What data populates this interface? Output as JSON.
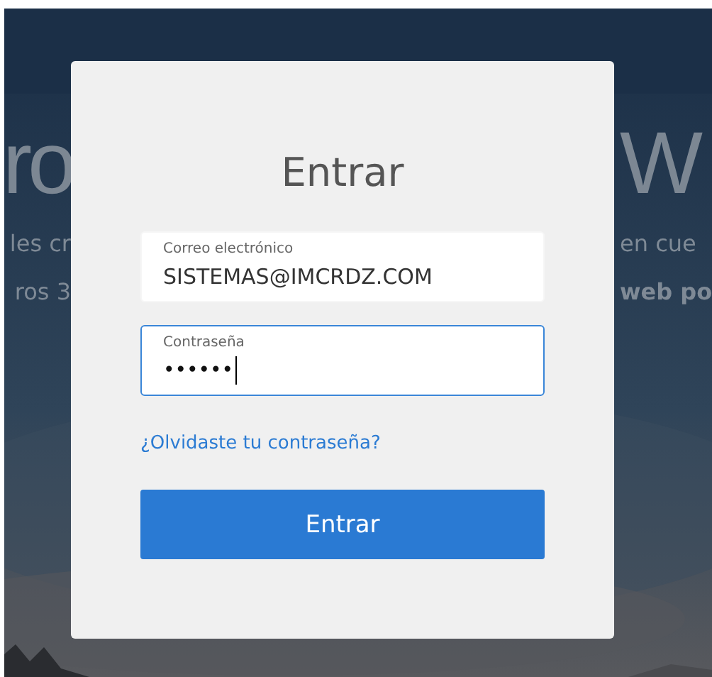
{
  "background": {
    "left_texts": [
      "ro",
      "les cr",
      "ros 3"
    ],
    "right_texts": [
      "W",
      "en cue",
      "web po"
    ]
  },
  "login": {
    "title": "Entrar",
    "fields": [
      {
        "label": "Correo electrónico",
        "value": "SISTEMAS@IMCRDZ.COM",
        "kind": "text",
        "focused": false
      },
      {
        "label": "Contraseña",
        "value": "••••••",
        "kind": "password",
        "focused": true
      }
    ],
    "link": "¿Olvidaste tu contraseña?",
    "button": "Entrar"
  }
}
